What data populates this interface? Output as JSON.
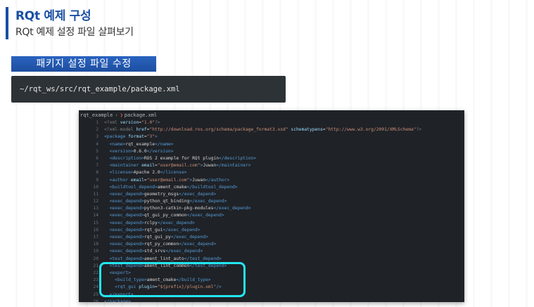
{
  "slide": {
    "title": "RQt 예제 구성",
    "subtitle": "RQt 예제 설정 파일 살펴보기",
    "section_tab": "패키지 설정 파일 수정",
    "path": "~/rqt_ws/src/rqt_example/package.xml"
  },
  "colors": {
    "accent": "#1a4fa3",
    "tag": "#569cd6",
    "attr": "#9cdcfe",
    "string": "#ce9178",
    "pi": "#808080",
    "text": "#d4d4d4",
    "highlight": "#22e6f0"
  },
  "editor": {
    "breadcrumb": {
      "folder": "rqt_example",
      "file": "package.xml",
      "file_icon": "xml-file-icon"
    },
    "lines": [
      {
        "n": "1",
        "tokens": [
          {
            "t": "<?xml ",
            "c": "pi"
          },
          {
            "t": "version",
            "c": "attr"
          },
          {
            "t": "=",
            "c": "text"
          },
          {
            "t": "\"1.0\"",
            "c": "string"
          },
          {
            "t": "?>",
            "c": "pi"
          }
        ]
      },
      {
        "n": "2",
        "tokens": [
          {
            "t": "<?xml-model ",
            "c": "pi"
          },
          {
            "t": "href",
            "c": "attr"
          },
          {
            "t": "=",
            "c": "text"
          },
          {
            "t": "\"http://download.ros.org/schema/package_format3.xsd\"",
            "c": "string"
          },
          {
            "t": " schematypens",
            "c": "attr"
          },
          {
            "t": "=",
            "c": "text"
          },
          {
            "t": "\"http://www.w3.org/2001/XMLSchema\"",
            "c": "string"
          },
          {
            "t": "?>",
            "c": "pi"
          }
        ]
      },
      {
        "n": "3",
        "tokens": [
          {
            "t": "<package ",
            "c": "tag"
          },
          {
            "t": "format",
            "c": "attr"
          },
          {
            "t": "=",
            "c": "text"
          },
          {
            "t": "\"3\"",
            "c": "string"
          },
          {
            "t": ">",
            "c": "tag"
          }
        ]
      },
      {
        "n": "4",
        "tokens": [
          {
            "t": "  <name>",
            "c": "tag"
          },
          {
            "t": "rqt_example",
            "c": "text"
          },
          {
            "t": "</name>",
            "c": "tag"
          }
        ]
      },
      {
        "n": "5",
        "tokens": [
          {
            "t": "  <version>",
            "c": "tag"
          },
          {
            "t": "0.6.0",
            "c": "text"
          },
          {
            "t": "</version>",
            "c": "tag"
          }
        ]
      },
      {
        "n": "6",
        "tokens": [
          {
            "t": "  <description>",
            "c": "tag"
          },
          {
            "t": "ROS 2 example for RQt plugin",
            "c": "text"
          },
          {
            "t": "</description>",
            "c": "tag"
          }
        ]
      },
      {
        "n": "7",
        "tokens": [
          {
            "t": "  <maintainer ",
            "c": "tag"
          },
          {
            "t": "email",
            "c": "attr"
          },
          {
            "t": "=",
            "c": "text"
          },
          {
            "t": "\"user@email.com\"",
            "c": "string"
          },
          {
            "t": ">",
            "c": "tag"
          },
          {
            "t": "Juwan",
            "c": "text"
          },
          {
            "t": "</maintainer>",
            "c": "tag"
          }
        ]
      },
      {
        "n": "8",
        "tokens": [
          {
            "t": "  <license>",
            "c": "tag"
          },
          {
            "t": "Apache 2.0",
            "c": "text"
          },
          {
            "t": "</license>",
            "c": "tag"
          }
        ]
      },
      {
        "n": "9",
        "tokens": [
          {
            "t": "  <author ",
            "c": "tag"
          },
          {
            "t": "email",
            "c": "attr"
          },
          {
            "t": "=",
            "c": "text"
          },
          {
            "t": "\"user@email.com\"",
            "c": "string"
          },
          {
            "t": ">",
            "c": "tag"
          },
          {
            "t": "Juwan",
            "c": "text"
          },
          {
            "t": "</author>",
            "c": "tag"
          }
        ]
      },
      {
        "n": "10",
        "tokens": [
          {
            "t": "  <buildtool_depend>",
            "c": "tag"
          },
          {
            "t": "ament_cmake",
            "c": "text"
          },
          {
            "t": "</buildtool_depend>",
            "c": "tag"
          }
        ]
      },
      {
        "n": "11",
        "tokens": [
          {
            "t": "  <exec_depend>",
            "c": "tag"
          },
          {
            "t": "geometry_msgs",
            "c": "text"
          },
          {
            "t": "</exec_depend>",
            "c": "tag"
          }
        ]
      },
      {
        "n": "12",
        "tokens": [
          {
            "t": "  <exec_depend>",
            "c": "tag"
          },
          {
            "t": "python_qt_binding",
            "c": "text"
          },
          {
            "t": "</exec_depend>",
            "c": "tag"
          }
        ]
      },
      {
        "n": "13",
        "tokens": [
          {
            "t": "  <exec_depend>",
            "c": "tag"
          },
          {
            "t": "python3-catkin-pkg-modules",
            "c": "text"
          },
          {
            "t": "</exec_depend>",
            "c": "tag"
          }
        ]
      },
      {
        "n": "14",
        "tokens": [
          {
            "t": "  <exec_depend>",
            "c": "tag"
          },
          {
            "t": "qt_gui_py_common",
            "c": "text"
          },
          {
            "t": "</exec_depend>",
            "c": "tag"
          }
        ]
      },
      {
        "n": "15",
        "tokens": [
          {
            "t": "  <exec_depend>",
            "c": "tag"
          },
          {
            "t": "rclpy",
            "c": "text"
          },
          {
            "t": "</exec_depend>",
            "c": "tag"
          }
        ]
      },
      {
        "n": "16",
        "tokens": [
          {
            "t": "  <exec_depend>",
            "c": "tag"
          },
          {
            "t": "rqt_gui",
            "c": "text"
          },
          {
            "t": "</exec_depend>",
            "c": "tag"
          }
        ]
      },
      {
        "n": "17",
        "tokens": [
          {
            "t": "  <exec_depend>",
            "c": "tag"
          },
          {
            "t": "rqt_gui_py",
            "c": "text"
          },
          {
            "t": "</exec_depend>",
            "c": "tag"
          }
        ]
      },
      {
        "n": "18",
        "tokens": [
          {
            "t": "  <exec_depend>",
            "c": "tag"
          },
          {
            "t": "rqt_py_common",
            "c": "text"
          },
          {
            "t": "</exec_depend>",
            "c": "tag"
          }
        ]
      },
      {
        "n": "19",
        "tokens": [
          {
            "t": "  <exec_depend>",
            "c": "tag"
          },
          {
            "t": "std_srvs",
            "c": "text"
          },
          {
            "t": "</exec_depend>",
            "c": "tag"
          }
        ]
      },
      {
        "n": "20",
        "tokens": [
          {
            "t": "  <test_depend>",
            "c": "tag"
          },
          {
            "t": "ament_lint_auto",
            "c": "text"
          },
          {
            "t": "</test_depend>",
            "c": "tag"
          }
        ]
      },
      {
        "n": "21",
        "tokens": [
          {
            "t": "  <test_depend>",
            "c": "tag"
          },
          {
            "t": "ament_lint_common",
            "c": "text"
          },
          {
            "t": "</test_depend>",
            "c": "tag"
          }
        ]
      },
      {
        "n": "22",
        "tokens": [
          {
            "t": "  <export>",
            "c": "tag"
          }
        ]
      },
      {
        "n": "23",
        "tokens": [
          {
            "t": "    <build_type>",
            "c": "tag"
          },
          {
            "t": "ament_cmake",
            "c": "text"
          },
          {
            "t": "</build_type>",
            "c": "tag"
          }
        ]
      },
      {
        "n": "24",
        "tokens": [
          {
            "t": "    <rqt_gui ",
            "c": "tag"
          },
          {
            "t": "plugin",
            "c": "attr"
          },
          {
            "t": "=",
            "c": "text"
          },
          {
            "t": "\"${prefix}/plugin.xml\"",
            "c": "string"
          },
          {
            "t": "/>",
            "c": "tag"
          }
        ]
      },
      {
        "n": "25",
        "tokens": [
          {
            "t": "  </export>",
            "c": "tag"
          }
        ]
      },
      {
        "n": "26",
        "tokens": [
          {
            "t": "</package>",
            "c": "tag"
          }
        ]
      }
    ]
  }
}
